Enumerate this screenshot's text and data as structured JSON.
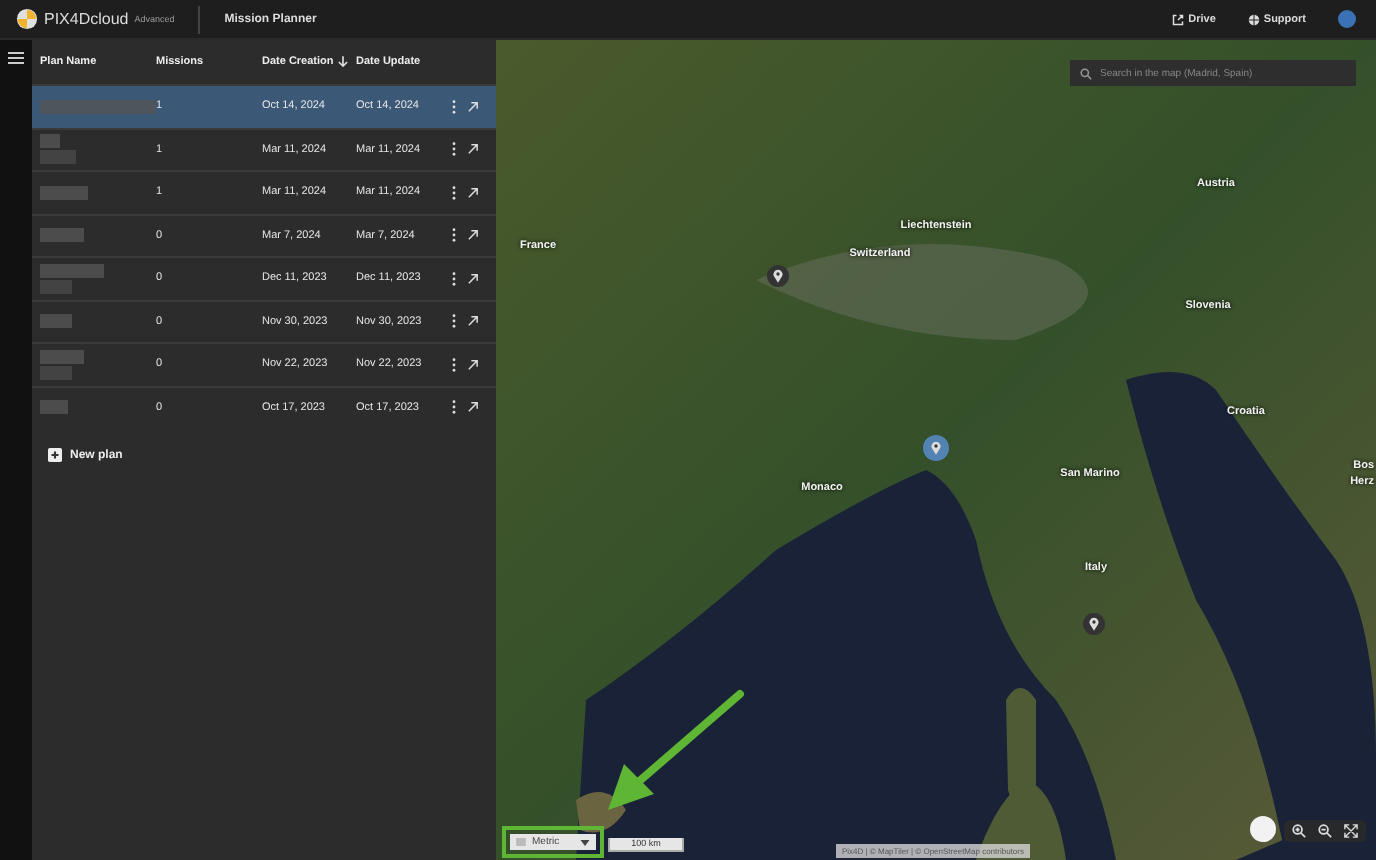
{
  "top_bar": {
    "brand": "PIX4D**cloud**",
    "edition": "Advanced",
    "page_title": "Mission Planner",
    "links": [
      {
        "kind": "drive",
        "label": "Drive"
      },
      {
        "kind": "support",
        "label": "Support"
      }
    ]
  },
  "table": {
    "columns": [
      {
        "label": "Plan Name",
        "sorted": false
      },
      {
        "label": "Missions",
        "sorted": false
      },
      {
        "label": "Date Creation",
        "sorted": true
      },
      {
        "label": "Date Update",
        "sorted": false
      }
    ],
    "rows": [
      {
        "missions": "1",
        "created": "Oct 14, 2024",
        "updated": "Oct 14, 2024",
        "selected": true
      },
      {
        "missions": "1",
        "created": "Mar 11, 2024",
        "updated": "Mar 11, 2024",
        "selected": false
      },
      {
        "missions": "1",
        "created": "Mar 11, 2024",
        "updated": "Mar 11, 2024",
        "selected": false
      },
      {
        "missions": "0",
        "created": "Mar 7, 2024",
        "updated": "Mar 7, 2024",
        "selected": false
      },
      {
        "missions": "0",
        "created": "Dec 11, 2023",
        "updated": "Dec 11, 2023",
        "selected": false
      },
      {
        "missions": "0",
        "created": "Nov 30, 2023",
        "updated": "Nov 30, 2023",
        "selected": false
      },
      {
        "missions": "0",
        "created": "Nov 22, 2023",
        "updated": "Nov 22, 2023",
        "selected": false
      },
      {
        "missions": "0",
        "created": "Oct 17, 2023",
        "updated": "Oct 17, 2023",
        "selected": false
      }
    ]
  },
  "new_plan_button": "New plan",
  "map": {
    "search": {
      "placeholder": "Search in the map (Madrid, Spain)"
    },
    "labels": [
      "France",
      "Liechtenstein",
      "Switzerland",
      "Austria",
      "Slovenia",
      "Croatia",
      "Monaco",
      "San Marino",
      "Italy",
      "Bos",
      "Herz"
    ],
    "markers": [
      {
        "selected": false
      },
      {
        "selected": true
      },
      {
        "selected": false
      }
    ],
    "units": "Metric",
    "scale": "100 km",
    "attribution": "Pix4D | © MapTiler | © OpenStreetMap contributors"
  }
}
